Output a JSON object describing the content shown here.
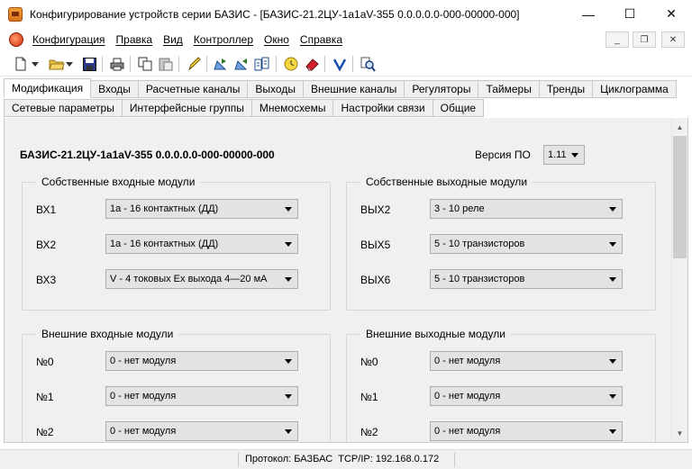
{
  "window": {
    "title": "Конфигурирование устройств серии БАЗИС - [БАЗИС-21.2ЦУ-1a1aV-355 0.0.0.0.0-000-00000-000]",
    "controls": {
      "minimize": "—",
      "maximize": "☐",
      "close": "✕"
    }
  },
  "menu": {
    "items": [
      "Конфигурация",
      "Правка",
      "Вид",
      "Контроллер",
      "Окно",
      "Справка"
    ],
    "mdi": {
      "minimize": "_",
      "restore": "❐",
      "close": "✕"
    }
  },
  "toolbar": {
    "icons": [
      "new-document-icon",
      "dropdown-arrow-icon",
      "open-folder-icon",
      "dropdown-arrow-icon",
      "save-icon",
      "print-icon",
      "copy-icon",
      "paste-icon",
      "pencil-tool-icon",
      "read-config-icon",
      "write-config-icon",
      "compare-config-icon",
      "clock-icon",
      "erase-icon",
      "check-icon",
      "search-icon"
    ]
  },
  "tabs": {
    "row1": [
      "Модификация",
      "Входы",
      "Расчетные каналы",
      "Выходы",
      "Внешние каналы",
      "Регуляторы",
      "Таймеры",
      "Тренды",
      "Циклограмма"
    ],
    "row2": [
      "Сетевые параметры",
      "Интерфейсные группы",
      "Мнемосхемы",
      "Настройки связи",
      "Общие"
    ],
    "active": "Модификация"
  },
  "modification": {
    "device_name": "БАЗИС-21.2ЦУ-1a1aV-355 0.0.0.0.0-000-00000-000",
    "fw_version_label": "Версия ПО",
    "fw_version_value": "1.11",
    "own_inputs": {
      "title": "Собственные входные модули",
      "rows": [
        {
          "label": "ВХ1",
          "value": "1a - 16 контактных (ДД)"
        },
        {
          "label": "ВХ2",
          "value": "1a - 16 контактных (ДД)"
        },
        {
          "label": "ВХ3",
          "value": "V - 4 токовых Ex выхода 4—20 мА"
        }
      ]
    },
    "own_outputs": {
      "title": "Собственные выходные модули",
      "rows": [
        {
          "label": "ВЫХ2",
          "value": "3 - 10 реле"
        },
        {
          "label": "ВЫХ5",
          "value": "5 - 10 транзисторов"
        },
        {
          "label": "ВЫХ6",
          "value": "5 - 10 транзисторов"
        }
      ]
    },
    "ext_inputs": {
      "title": "Внешние входные модули",
      "rows": [
        {
          "label": "№0",
          "value": "0 - нет модуля"
        },
        {
          "label": "№1",
          "value": "0 - нет модуля"
        },
        {
          "label": "№2",
          "value": "0 - нет модуля"
        }
      ]
    },
    "ext_outputs": {
      "title": "Внешние выходные модули",
      "rows": [
        {
          "label": "№0",
          "value": "0 - нет модуля"
        },
        {
          "label": "№1",
          "value": "0 - нет модуля"
        },
        {
          "label": "№2",
          "value": "0 - нет модуля"
        }
      ]
    }
  },
  "statusbar": {
    "protocol_label": "Протокол:",
    "protocol_value": "БАЗБАС",
    "tcp_label": "TCP/IP:",
    "tcp_value": "192.168.0.172"
  }
}
